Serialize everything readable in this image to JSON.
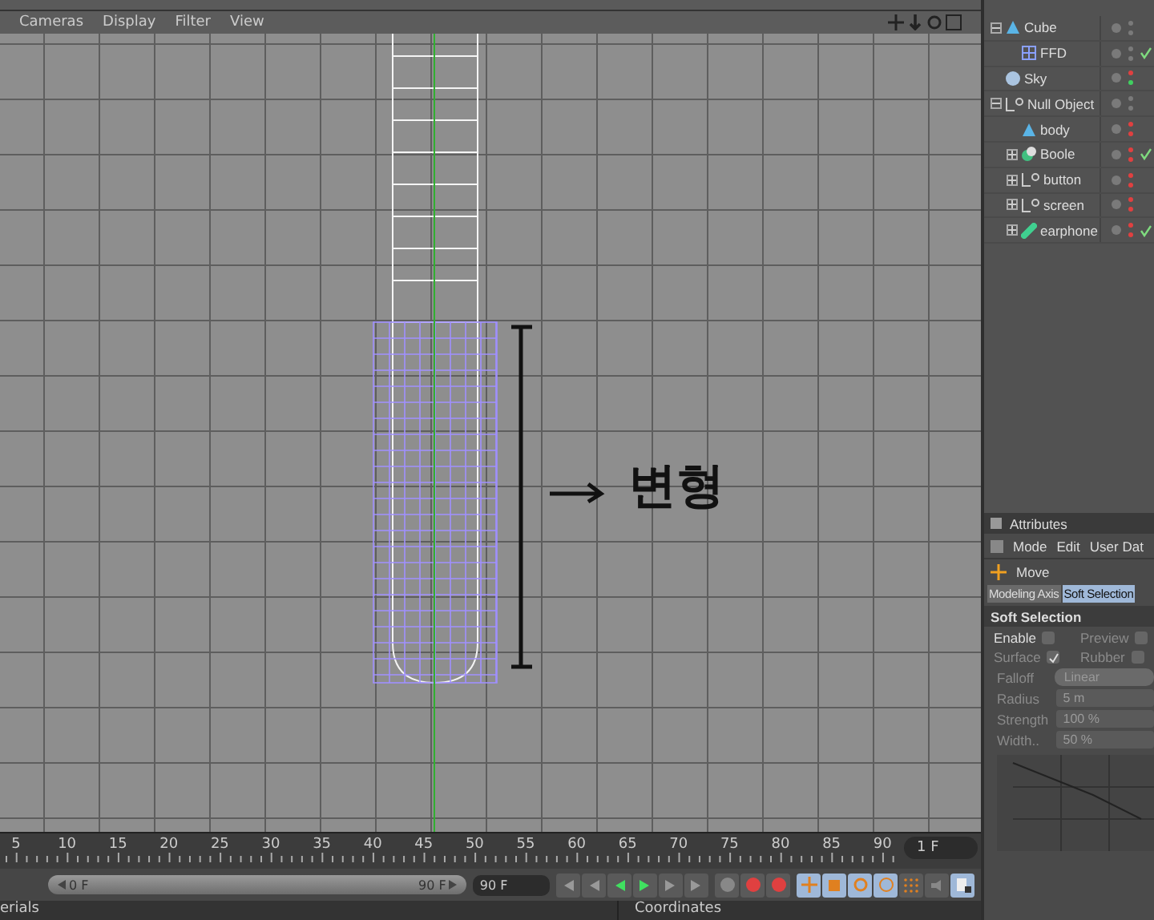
{
  "viewport": {
    "menu": [
      "Cameras",
      "Display",
      "Filter",
      "View"
    ],
    "annotation": "변형"
  },
  "object_manager": {
    "objects": [
      {
        "name": "Cube",
        "kind": "polygon",
        "expanded": true,
        "checked": false,
        "dots": [
          {
            "color": "#7a7a7a"
          },
          {
            "color": "#7a7a7a"
          }
        ],
        "children": [
          {
            "name": "FFD",
            "kind": "lattice",
            "checked": true,
            "dots": [
              {
                "color": "#7a7a7a"
              },
              {
                "color": "#7a7a7a"
              }
            ]
          }
        ]
      },
      {
        "name": "Sky",
        "kind": "sphere",
        "checked": false,
        "dots": [
          {
            "color": "#e04040"
          },
          {
            "color": "#40d060"
          }
        ]
      },
      {
        "name": "Null Object",
        "kind": "null",
        "expanded": true,
        "checked": false,
        "dots": [
          {
            "color": "#7a7a7a"
          },
          {
            "color": "#7a7a7a"
          }
        ],
        "children": [
          {
            "name": "body",
            "kind": "polygon",
            "checked": false,
            "dots": [
              {
                "color": "#e04040"
              },
              {
                "color": "#e04040"
              }
            ]
          },
          {
            "name": "Boole",
            "kind": "boole",
            "expanded": false,
            "checked": true,
            "dots": [
              {
                "color": "#e04040"
              },
              {
                "color": "#e04040"
              }
            ]
          },
          {
            "name": "button",
            "kind": "null",
            "expanded": false,
            "checked": false,
            "dots": [
              {
                "color": "#e04040"
              },
              {
                "color": "#e04040"
              }
            ]
          },
          {
            "name": "screen",
            "kind": "null",
            "expanded": false,
            "checked": false,
            "dots": [
              {
                "color": "#e04040"
              },
              {
                "color": "#e04040"
              }
            ]
          },
          {
            "name": "earphone",
            "kind": "capsule",
            "expanded": false,
            "checked": true,
            "dots": [
              {
                "color": "#e04040"
              },
              {
                "color": "#e04040"
              }
            ]
          }
        ]
      }
    ]
  },
  "attributes": {
    "title": "Attributes",
    "menu": [
      "Mode",
      "Edit",
      "User Dat"
    ],
    "tool": "Move",
    "tabs": [
      {
        "label": "Modeling Axis",
        "selected": false
      },
      {
        "label": "Soft Selection",
        "selected": true
      }
    ],
    "section": "Soft Selection",
    "checks": [
      {
        "label": "Enable",
        "checked": false,
        "disabled": false
      },
      {
        "label": "Preview",
        "checked": false,
        "disabled": true
      },
      {
        "label": "Surface",
        "checked": true,
        "disabled": true
      },
      {
        "label": "Rubber",
        "checked": false,
        "disabled": true
      }
    ],
    "falloff": {
      "label": "Falloff",
      "value": "Linear"
    },
    "fields": [
      {
        "label": "Radius",
        "value": "5 m"
      },
      {
        "label": "Strength",
        "value": "100 %"
      },
      {
        "label": "Width..",
        "value": "50 %"
      }
    ]
  },
  "timeline": {
    "ticks": [
      "5",
      "10",
      "15",
      "20",
      "25",
      "30",
      "35",
      "40",
      "45",
      "50",
      "55",
      "60",
      "65",
      "70",
      "75",
      "80",
      "85",
      "90"
    ],
    "frame": "1 F",
    "range_start": "0 F",
    "range_end": "90 F",
    "end_field": "90 F"
  },
  "bottom": {
    "left": "erials",
    "right": "Coordinates"
  }
}
